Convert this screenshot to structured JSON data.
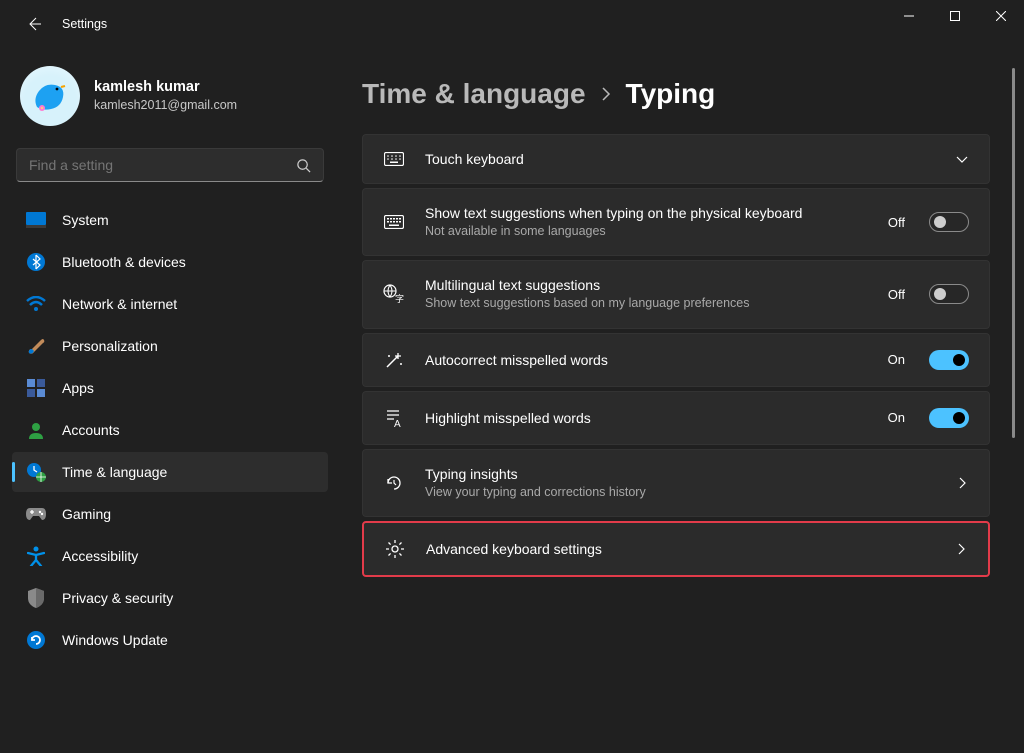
{
  "window": {
    "title": "Settings"
  },
  "user": {
    "name": "kamlesh kumar",
    "email": "kamlesh2011@gmail.com"
  },
  "search": {
    "placeholder": "Find a setting"
  },
  "nav": {
    "items": [
      {
        "label": "System"
      },
      {
        "label": "Bluetooth & devices"
      },
      {
        "label": "Network & internet"
      },
      {
        "label": "Personalization"
      },
      {
        "label": "Apps"
      },
      {
        "label": "Accounts"
      },
      {
        "label": "Time & language"
      },
      {
        "label": "Gaming"
      },
      {
        "label": "Accessibility"
      },
      {
        "label": "Privacy & security"
      },
      {
        "label": "Windows Update"
      }
    ]
  },
  "breadcrumb": {
    "parent": "Time & language",
    "current": "Typing"
  },
  "cards": {
    "touch_keyboard": {
      "title": "Touch keyboard"
    },
    "text_suggestions": {
      "title": "Show text suggestions when typing on the physical keyboard",
      "sub": "Not available in some languages",
      "state": "Off"
    },
    "multilingual": {
      "title": "Multilingual text suggestions",
      "sub": "Show text suggestions based on my language preferences",
      "state": "Off"
    },
    "autocorrect": {
      "title": "Autocorrect misspelled words",
      "state": "On"
    },
    "highlight": {
      "title": "Highlight misspelled words",
      "state": "On"
    },
    "insights": {
      "title": "Typing insights",
      "sub": "View your typing and corrections history"
    },
    "advanced": {
      "title": "Advanced keyboard settings"
    }
  }
}
